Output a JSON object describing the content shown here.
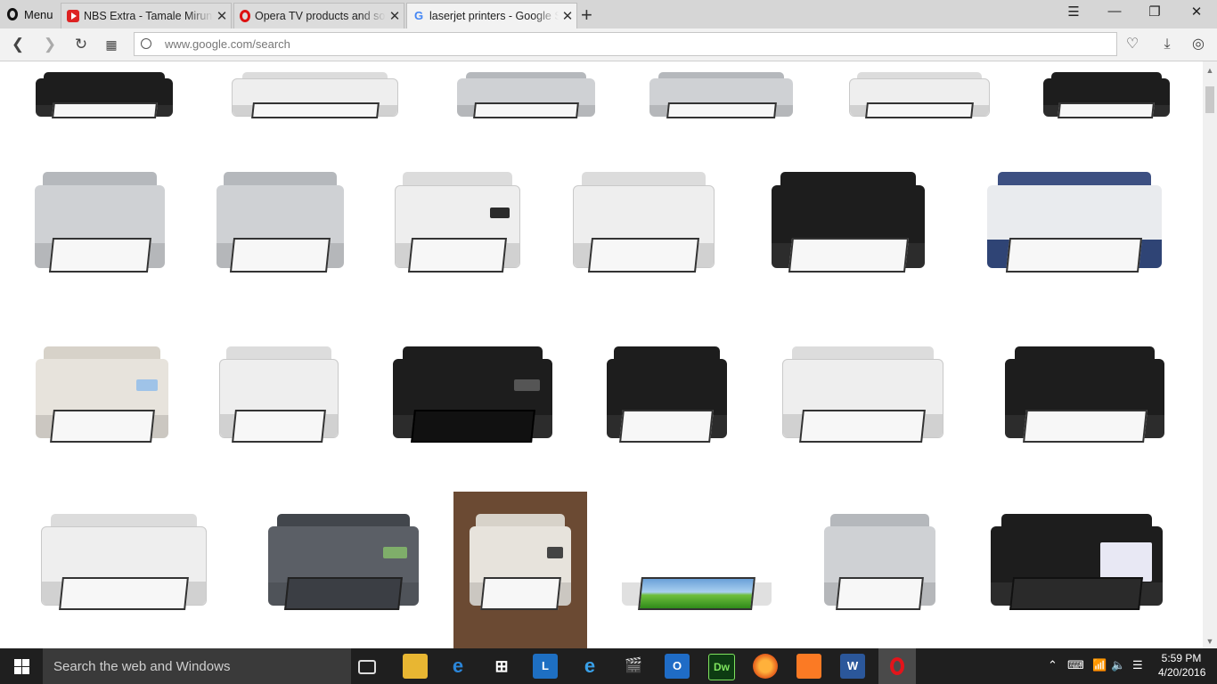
{
  "browser": {
    "menu_label": "Menu",
    "tabs": [
      {
        "title": "NBS Extra - Tamale Mirunda",
        "favicon": "youtube-icon",
        "active": false
      },
      {
        "title": "Opera TV products and so",
        "favicon": "opera-icon",
        "active": false
      },
      {
        "title": "laserjet printers - Google S",
        "favicon": "google-icon",
        "active": true
      }
    ],
    "new_tab_glyph": "+",
    "url": "www.google.com/search",
    "accent": "#d6d6d6"
  },
  "results": {
    "rows": 4,
    "images": [
      {
        "alt": "printer image 1",
        "style": "black"
      },
      {
        "alt": "printer image 2",
        "style": "flowers"
      },
      {
        "alt": "printer image 3",
        "style": "silver"
      },
      {
        "alt": "printer image 4",
        "style": "silver"
      },
      {
        "alt": "printer image 5",
        "style": "white"
      },
      {
        "alt": "printer image 6",
        "style": "black"
      },
      {
        "alt": "printer image 7",
        "style": "silver"
      },
      {
        "alt": "printer image 8",
        "style": "silver"
      },
      {
        "alt": "printer image 9",
        "style": "white"
      },
      {
        "alt": "printer image 10",
        "style": "white"
      },
      {
        "alt": "printer image 11",
        "style": "black"
      },
      {
        "alt": "printer image 12",
        "style": "blue"
      },
      {
        "alt": "printer image 13",
        "style": "beige"
      },
      {
        "alt": "printer image 14",
        "style": "white"
      },
      {
        "alt": "printer image 15",
        "style": "black"
      },
      {
        "alt": "printer image 16",
        "style": "black"
      },
      {
        "alt": "printer image 17",
        "style": "white"
      },
      {
        "alt": "printer image 18",
        "style": "black"
      },
      {
        "alt": "printer image 19",
        "style": "white"
      },
      {
        "alt": "printer image 20",
        "style": "grey"
      },
      {
        "alt": "printer image 21",
        "style": "beige"
      },
      {
        "alt": "printer image 22",
        "style": "photo"
      },
      {
        "alt": "printer image 23",
        "style": "silver"
      },
      {
        "alt": "printer image 24",
        "style": "black"
      }
    ]
  },
  "taskbar": {
    "search_placeholder": "Search the web and Windows",
    "apps": [
      "task-view-icon",
      "file-explorer-icon",
      "edge-icon",
      "store-icon",
      "lync-icon",
      "internet-explorer-icon",
      "movie-maker-icon",
      "outlook-icon",
      "dreamweaver-icon",
      "firefox-icon",
      "xampp-icon",
      "word-icon",
      "opera-icon"
    ],
    "app_labels": {
      "lync": "L",
      "outlook": "O",
      "dreamweaver": "Dw",
      "word": "W"
    },
    "time": "5:59 PM",
    "date": "4/20/2016",
    "taskbar_color": "#1f1f1f"
  }
}
